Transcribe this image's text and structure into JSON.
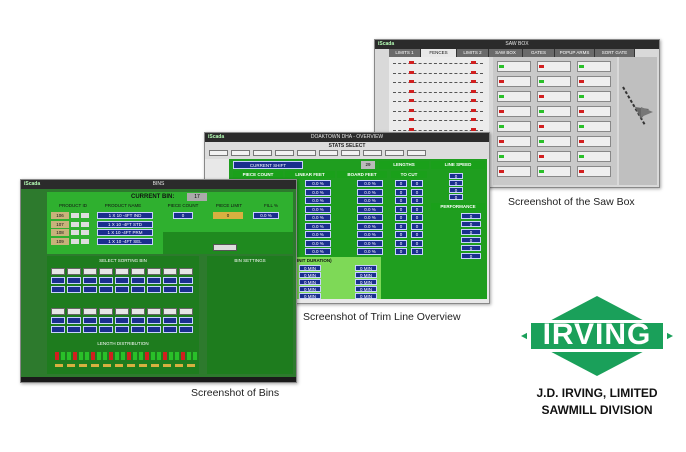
{
  "captions": {
    "saw_box": "Screenshot of the Saw Box",
    "trim_line": "Screenshot of Trim Line Overview",
    "bins": "Screenshot of Bins"
  },
  "logo": {
    "word": "IRVING",
    "line1": "J.D. IRVING, LIMITED",
    "line2": "SAWMILL DIVISION",
    "green": "#1aa05a"
  },
  "saw_box": {
    "app_name": "iScada",
    "window_title": "SAW BOX",
    "tabs": [
      "LIMITS 1",
      "FENCES",
      "LIMITS 2",
      "SAW BOX",
      "GATES",
      "POPUP ARMS",
      "SORT GATE"
    ],
    "active_tab": "FENCES"
  },
  "trim_line": {
    "app_name": "iScada",
    "window_title": "DOAKTOWN DHA - OVERVIEW",
    "stats_select": "STATS SELECT",
    "current_shift": "CURRENT SHIFT",
    "shift_value": "29",
    "lengths": "LENGTHS",
    "line_speed": "LINE SPEED",
    "columns": [
      "PIECE COUNT",
      "LINEAR FEET",
      "BOARD FEET"
    ],
    "to_cut": "TO CUT",
    "performance": "PERFORMANCE",
    "unit_duration": "UNIT DURATION)",
    "pct_rows": [
      "0.0 %",
      "0.0 %",
      "0.0 %",
      "0.0 %",
      "0.0 %"
    ],
    "zero": "0",
    "min_label": "0 MIN"
  },
  "bins": {
    "app_name": "iScada",
    "window_title": "BINS",
    "current_bin_label": "CURRENT BIN:",
    "current_bin_value": "17",
    "columns": [
      "PRODUCT ID",
      "PRODUCT NAME",
      "PIECE COUNT",
      "PIECE LIMIT",
      "FILL %"
    ],
    "product_ids": [
      "106",
      "107",
      "108",
      "109"
    ],
    "product_names": [
      "1 X 10 -4FT IND",
      "1 X 10 -4FT STD",
      "1 X 10 -4FT PRM",
      "1 X 10 -4FT SEL"
    ],
    "piece_count": "0",
    "piece_limit": "0",
    "fill": "0.0 %",
    "select_sorting_bin": "SELECT SORTING BIN",
    "bin_settings": "BIN SETTINGS",
    "length_distribution": "LENGTH DISTRIBUTION"
  }
}
